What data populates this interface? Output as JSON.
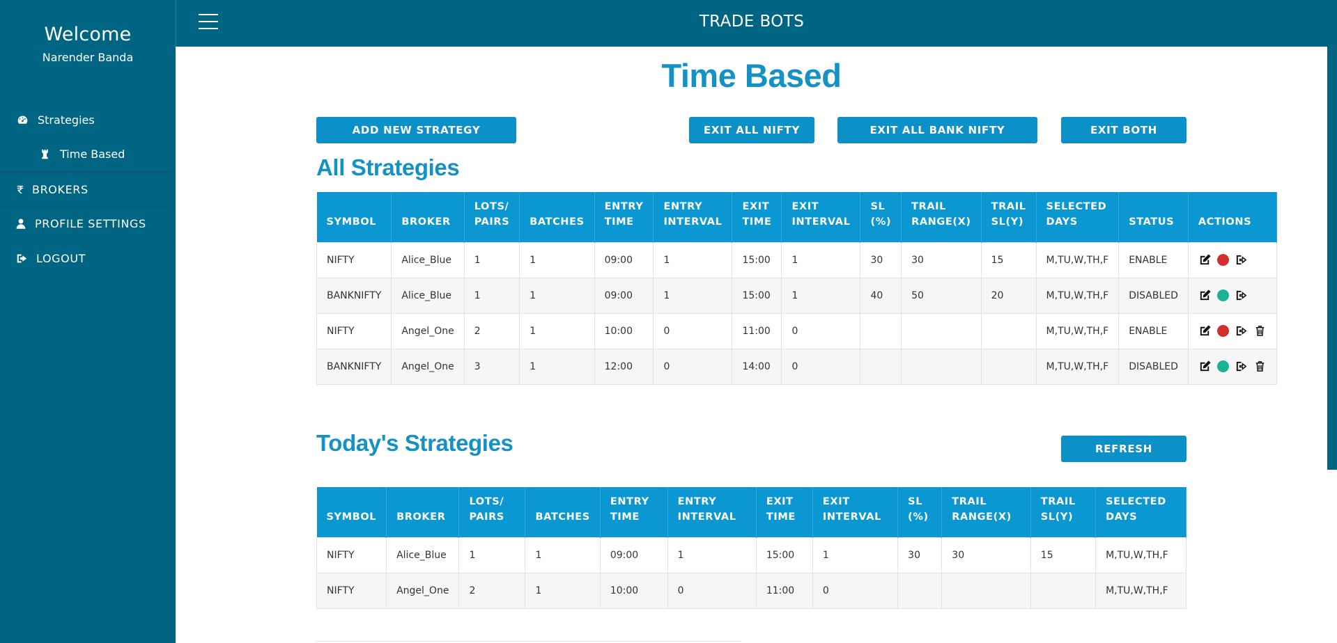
{
  "sidebar": {
    "welcome": "Welcome",
    "user_name": "Narender Banda",
    "items": [
      {
        "label": "Strategies",
        "icon": "dashboard-icon"
      },
      {
        "label": "Time Based",
        "icon": "chess-rook-icon"
      },
      {
        "label": "BROKERS",
        "icon": "rupee-icon"
      },
      {
        "label": "PROFILE SETTINGS",
        "icon": "user-icon"
      },
      {
        "label": "LOGOUT",
        "icon": "sign-out-icon"
      }
    ]
  },
  "topbar": {
    "title": "TRADE BOTS"
  },
  "page": {
    "title": "Time Based"
  },
  "buttons": {
    "add_new": "ADD NEW STRATEGY",
    "exit_nifty": "EXIT ALL NIFTY",
    "exit_bank": "EXIT ALL BANK NIFTY",
    "exit_both": "EXIT BOTH",
    "refresh": "REFRESH"
  },
  "all_strategies": {
    "title": "All Strategies",
    "headers": [
      [
        "SYMBOL"
      ],
      [
        "BROKER"
      ],
      [
        "LOTS/",
        "PAIRS"
      ],
      [
        "BATCHES"
      ],
      [
        "ENTRY",
        "TIME"
      ],
      [
        "ENTRY",
        "INTERVAL"
      ],
      [
        "EXIT",
        "TIME"
      ],
      [
        "EXIT",
        "INTERVAL"
      ],
      [
        "SL",
        "(%)"
      ],
      [
        "TRAIL",
        "RANGE(X)"
      ],
      [
        "TRAIL",
        "SL(Y)"
      ],
      [
        "SELECTED",
        "DAYS"
      ],
      [
        "STATUS"
      ],
      [
        "ACTIONS"
      ]
    ],
    "rows": [
      {
        "cells": [
          "NIFTY",
          "Alice_Blue",
          "1",
          "1",
          "09:00",
          "1",
          "15:00",
          "1",
          "30",
          "30",
          "15",
          "M,TU,W,TH,F",
          "ENABLE"
        ],
        "status_color": "#d32f2f",
        "deletable": false
      },
      {
        "cells": [
          "BANKNIFTY",
          "Alice_Blue",
          "1",
          "1",
          "09:00",
          "1",
          "15:00",
          "1",
          "40",
          "50",
          "20",
          "M,TU,W,TH,F",
          "DISABLED"
        ],
        "status_color": "#1ab394",
        "deletable": false
      },
      {
        "cells": [
          "NIFTY",
          "Angel_One",
          "2",
          "1",
          "10:00",
          "0",
          "11:00",
          "0",
          "",
          "",
          "",
          "M,TU,W,TH,F",
          "ENABLE"
        ],
        "status_color": "#d32f2f",
        "deletable": true
      },
      {
        "cells": [
          "BANKNIFTY",
          "Angel_One",
          "3",
          "1",
          "12:00",
          "0",
          "14:00",
          "0",
          "",
          "",
          "",
          "M,TU,W,TH,F",
          "DISABLED"
        ],
        "status_color": "#1ab394",
        "deletable": true
      }
    ]
  },
  "todays_strategies": {
    "title": "Today's Strategies",
    "headers": [
      [
        "SYMBOL"
      ],
      [
        "BROKER"
      ],
      [
        "LOTS/",
        "PAIRS"
      ],
      [
        "BATCHES"
      ],
      [
        "ENTRY",
        "TIME"
      ],
      [
        "ENTRY",
        "INTERVAL"
      ],
      [
        "EXIT",
        "TIME"
      ],
      [
        "EXIT",
        "INTERVAL"
      ],
      [
        "SL",
        "(%)"
      ],
      [
        "TRAIL",
        "RANGE(X)"
      ],
      [
        "TRAIL",
        "SL(Y)"
      ],
      [
        "SELECTED",
        "DAYS"
      ]
    ],
    "rows": [
      [
        "NIFTY",
        "Alice_Blue",
        "1",
        "1",
        "09:00",
        "1",
        "15:00",
        "1",
        "30",
        "30",
        "15",
        "M,TU,W,TH,F"
      ],
      [
        "NIFTY",
        "Angel_One",
        "2",
        "1",
        "10:00",
        "0",
        "11:00",
        "0",
        "",
        "",
        "",
        "M,TU,W,TH,F"
      ]
    ]
  }
}
